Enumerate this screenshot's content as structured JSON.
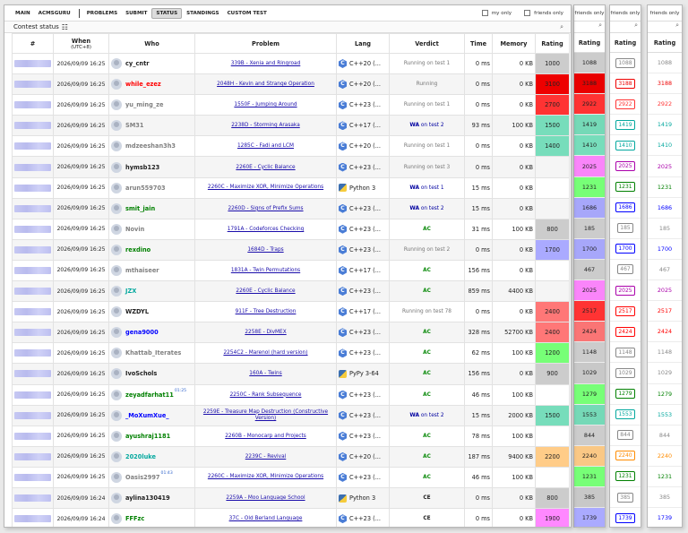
{
  "nav": {
    "items": [
      "MAIN",
      "ACMSGURU",
      "PROBLEMS",
      "SUBMIT",
      "STATUS",
      "STANDINGS",
      "CUSTOM TEST"
    ],
    "active": "STATUS",
    "my_only": "my only",
    "friends_only": "friends only"
  },
  "status": {
    "title": "Contest status"
  },
  "table": {
    "headers": {
      "id": "#",
      "when": "When",
      "when_sub": "(UTC+8)",
      "who": "Who",
      "problem": "Problem",
      "lang": "Lang",
      "verdict": "Verdict",
      "time": "Time",
      "memory": "Memory",
      "rating": "Rating"
    },
    "rows": [
      {
        "when": "2026/09/09 16:25",
        "who": "cy_cntr",
        "who_color": "black",
        "problem": "339B - Xenia and Ringroad",
        "lang": "C++20 (...",
        "lang_icon": "cpp",
        "verdict_type": "running",
        "verdict": "Running on test 1",
        "time": "0 ms",
        "memory": "0 KB",
        "rating": "1000",
        "rating_color": "#cccccc",
        "p1": "1088",
        "p1c": "#cccccc",
        "p2": "1088",
        "p2c": "#888888",
        "p3": "1088",
        "p3c": "#888888"
      },
      {
        "when": "2026/09/09 16:25",
        "who": "while_ezez",
        "who_color": "red",
        "problem": "2048H - Kevin and Strange Operation",
        "lang": "C++20 (...",
        "lang_icon": "cpp",
        "verdict_type": "running",
        "verdict": "Running",
        "time": "0 ms",
        "memory": "0 KB",
        "rating": "3100",
        "rating_color": "#ee0000",
        "p1": "3188",
        "p1c": "#ee0000",
        "p2": "3188",
        "p2c": "#ee0000",
        "p3": "3188",
        "p3c": "#ee0000"
      },
      {
        "when": "2026/09/09 16:25",
        "who": "yu_ming_ze",
        "who_color": "gray",
        "problem": "1550F - Jumping Around",
        "lang": "C++23 (...",
        "lang_icon": "cpp",
        "verdict_type": "running",
        "verdict": "Running on test 1",
        "time": "0 ms",
        "memory": "0 KB",
        "rating": "2700",
        "rating_color": "#ff3333",
        "p1": "2922",
        "p1c": "#ff3333",
        "p2": "2922",
        "p2c": "#ff3333",
        "p3": "2922",
        "p3c": "#ff3333"
      },
      {
        "when": "2026/09/09 16:25",
        "who": "SM31",
        "who_color": "gray",
        "problem": "2238D - Storming Arasaka",
        "lang": "C++17 (...",
        "lang_icon": "cpp",
        "verdict_type": "wa",
        "verdict_prefix": "WA",
        "verdict": "on test 2",
        "time": "93 ms",
        "memory": "100 KB",
        "rating": "1500",
        "rating_color": "#77ddbb",
        "p1": "1419",
        "p1c": "#77ddbb",
        "p2": "1419",
        "p2c": "#03a89e",
        "p3": "1419",
        "p3c": "#03a89e"
      },
      {
        "when": "2026/09/09 16:25",
        "who": "mdzeeshan3h3",
        "who_color": "gray",
        "problem": "1285C - Fadi and LCM",
        "lang": "C++20 (...",
        "lang_icon": "cpp",
        "verdict_type": "running",
        "verdict": "Running on test 1",
        "time": "0 ms",
        "memory": "0 KB",
        "rating": "1400",
        "rating_color": "#77ddbb",
        "p1": "1410",
        "p1c": "#77ddbb",
        "p2": "1410",
        "p2c": "#03a89e",
        "p3": "1410",
        "p3c": "#03a89e"
      },
      {
        "when": "2026/09/09 16:25",
        "who": "hymsb123",
        "who_color": "black",
        "problem": "2260E - Cyclic Balance",
        "lang": "C++23 (...",
        "lang_icon": "cpp",
        "verdict_type": "running",
        "verdict": "Running on test 3",
        "time": "0 ms",
        "memory": "0 KB",
        "rating": "",
        "rating_color": "",
        "p1": "2025",
        "p1c": "#ff88ff",
        "p2": "2025",
        "p2c": "#aa00aa",
        "p3": "2025",
        "p3c": "#aa00aa"
      },
      {
        "when": "2026/09/09 16:25",
        "who": "arun559703",
        "who_color": "gray",
        "problem": "2260C - Maximize XOR, Minimize Operations",
        "lang": "Python 3",
        "lang_icon": "py",
        "verdict_type": "wa",
        "verdict_prefix": "WA",
        "verdict": "on test 1",
        "time": "15 ms",
        "memory": "0 KB",
        "rating": "",
        "rating_color": "",
        "p1": "1231",
        "p1c": "#77ff77",
        "p2": "1231",
        "p2c": "#008000",
        "p3": "1231",
        "p3c": "#008000"
      },
      {
        "when": "2026/09/09 16:25",
        "who": "smit_jain",
        "who_color": "green",
        "problem": "2260D - Signs of Prefix Sums",
        "lang": "C++23 (...",
        "lang_icon": "cpp",
        "verdict_type": "wa",
        "verdict_prefix": "WA",
        "verdict": "on test 2",
        "time": "15 ms",
        "memory": "0 KB",
        "rating": "",
        "rating_color": "",
        "p1": "1686",
        "p1c": "#aaaaff",
        "p2": "1686",
        "p2c": "#0000ff",
        "p3": "1686",
        "p3c": "#0000ff"
      },
      {
        "when": "2026/09/09 16:25",
        "who": "Novin",
        "who_color": "gray",
        "problem": "1791A - Codeforces Checking",
        "lang": "C++23 (...",
        "lang_icon": "cpp",
        "verdict_type": "ac",
        "verdict": "AC",
        "time": "31 ms",
        "memory": "100 KB",
        "rating": "800",
        "rating_color": "#cccccc",
        "p1": "185",
        "p1c": "#cccccc",
        "p2": "185",
        "p2c": "#888888",
        "p3": "185",
        "p3c": "#888888"
      },
      {
        "when": "2026/09/09 16:25",
        "who": "rexdino",
        "who_color": "green",
        "problem": "1684D - Traps",
        "lang": "C++23 (...",
        "lang_icon": "cpp",
        "verdict_type": "running",
        "verdict": "Running on test 2",
        "time": "0 ms",
        "memory": "0 KB",
        "rating": "1700",
        "rating_color": "#aaaaff",
        "p1": "1700",
        "p1c": "#aaaaff",
        "p2": "1700",
        "p2c": "#0000ff",
        "p3": "1700",
        "p3c": "#0000ff"
      },
      {
        "when": "2026/09/09 16:25",
        "who": "mthaiseer",
        "who_color": "gray",
        "problem": "1831A - Twin Permutations",
        "lang": "C++17 (...",
        "lang_icon": "cpp",
        "verdict_type": "ac",
        "verdict": "AC",
        "time": "156 ms",
        "memory": "0 KB",
        "rating": "",
        "rating_color": "",
        "p1": "467",
        "p1c": "#cccccc",
        "p2": "467",
        "p2c": "#888888",
        "p3": "467",
        "p3c": "#888888"
      },
      {
        "when": "2026/09/09 16:25",
        "who": "JZX",
        "who_color": "cyan",
        "problem": "2260E - Cyclic Balance",
        "lang": "C++23 (...",
        "lang_icon": "cpp",
        "verdict_type": "ac",
        "verdict": "AC",
        "time": "859 ms",
        "memory": "4400 KB",
        "rating": "",
        "rating_color": "",
        "p1": "2025",
        "p1c": "#ff88ff",
        "p2": "2025",
        "p2c": "#aa00aa",
        "p3": "2025",
        "p3c": "#aa00aa"
      },
      {
        "when": "2026/09/09 16:25",
        "who": "WZDYL",
        "who_color": "black",
        "problem": "911F - Tree Destruction",
        "lang": "C++17 (...",
        "lang_icon": "cpp",
        "verdict_type": "running",
        "verdict": "Running on test 78",
        "time": "0 ms",
        "memory": "0 KB",
        "rating": "2400",
        "rating_color": "#ff7777",
        "p1": "2517",
        "p1c": "#ff3333",
        "p2": "2517",
        "p2c": "#ff0000",
        "p3": "2517",
        "p3c": "#ff0000"
      },
      {
        "when": "2026/09/09 16:25",
        "who": "gena9000",
        "who_color": "navy",
        "problem": "2258E - DivMEX",
        "lang": "C++23 (...",
        "lang_icon": "cpp",
        "verdict_type": "ac",
        "verdict": "AC",
        "time": "328 ms",
        "memory": "52700 KB",
        "rating": "2400",
        "rating_color": "#ff7777",
        "p1": "2424",
        "p1c": "#ff7777",
        "p2": "2424",
        "p2c": "#ff0000",
        "p3": "2424",
        "p3c": "#ff0000"
      },
      {
        "when": "2026/09/09 16:25",
        "who": "Khattab_Iterates",
        "who_color": "gray",
        "problem": "2254C2 - Marenol (hard version)",
        "lang": "C++23 (...",
        "lang_icon": "cpp",
        "verdict_type": "ac",
        "verdict": "AC",
        "time": "62 ms",
        "memory": "100 KB",
        "rating": "1200",
        "rating_color": "#77ff77",
        "p1": "1148",
        "p1c": "#cccccc",
        "p2": "1148",
        "p2c": "#888888",
        "p3": "1148",
        "p3c": "#888888"
      },
      {
        "when": "2026/09/09 16:25",
        "who": "IvoSchols",
        "who_color": "black",
        "problem": "160A - Twins",
        "lang": "PyPy 3-64",
        "lang_icon": "py",
        "verdict_type": "ac",
        "verdict": "AC",
        "time": "156 ms",
        "memory": "0 KB",
        "rating": "900",
        "rating_color": "#cccccc",
        "p1": "1029",
        "p1c": "#cccccc",
        "p2": "1029",
        "p2c": "#888888",
        "p3": "1029",
        "p3c": "#888888"
      },
      {
        "when": "2026/09/09 16:25",
        "who": "zeyadfarhat11",
        "who_color": "green",
        "who_sup": "01:25",
        "problem": "2250C - Rank Subsequence",
        "lang": "C++23 (...",
        "lang_icon": "cpp",
        "verdict_type": "ac",
        "verdict": "AC",
        "time": "46 ms",
        "memory": "100 KB",
        "rating": "",
        "rating_color": "",
        "p1": "1279",
        "p1c": "#77ff77",
        "p2": "1279",
        "p2c": "#008000",
        "p3": "1279",
        "p3c": "#008000"
      },
      {
        "when": "2026/09/09 16:25",
        "who": "_MoXumXue_",
        "who_color": "navy",
        "problem": "2259E - Treasure Map Destruction (Constructive Version)",
        "lang": "C++23 (...",
        "lang_icon": "cpp",
        "verdict_type": "wa",
        "verdict_prefix": "WA",
        "verdict": "on test 2",
        "time": "15 ms",
        "memory": "2000 KB",
        "rating": "1500",
        "rating_color": "#77ddbb",
        "p1": "1553",
        "p1c": "#77ddbb",
        "p2": "1553",
        "p2c": "#03a89e",
        "p3": "1553",
        "p3c": "#03a89e"
      },
      {
        "when": "2026/09/09 16:25",
        "who": "ayushraj1181",
        "who_color": "green",
        "problem": "2260B - Monocarp and Projects",
        "lang": "C++23 (...",
        "lang_icon": "cpp",
        "verdict_type": "ac",
        "verdict": "AC",
        "time": "78 ms",
        "memory": "100 KB",
        "rating": "",
        "rating_color": "",
        "p1": "844",
        "p1c": "#cccccc",
        "p2": "844",
        "p2c": "#888888",
        "p3": "844",
        "p3c": "#888888"
      },
      {
        "when": "2026/09/09 16:25",
        "who": "2020luke",
        "who_color": "cyan",
        "problem": "2239C - Revival",
        "lang": "C++20 (...",
        "lang_icon": "cpp",
        "verdict_type": "ac",
        "verdict": "AC",
        "time": "187 ms",
        "memory": "9400 KB",
        "rating": "2200",
        "rating_color": "#ffcc88",
        "p1": "2240",
        "p1c": "#ffcc88",
        "p2": "2240",
        "p2c": "#ff8c00",
        "p3": "2240",
        "p3c": "#ff8c00"
      },
      {
        "when": "2026/09/09 16:25",
        "who": "Oasis2997",
        "who_color": "gray",
        "who_sup": "01:43",
        "problem": "2260C - Maximize XOR, Minimize Operations",
        "lang": "C++23 (...",
        "lang_icon": "cpp",
        "verdict_type": "ac",
        "verdict": "AC",
        "time": "46 ms",
        "memory": "100 KB",
        "rating": "",
        "rating_color": "",
        "p1": "1231",
        "p1c": "#77ff77",
        "p2": "1231",
        "p2c": "#008000",
        "p3": "1231",
        "p3c": "#008000"
      },
      {
        "when": "2026/09/09 16:24",
        "who": "aylina130419",
        "who_color": "black",
        "problem": "2259A - Moo Language School",
        "lang": "Python 3",
        "lang_icon": "py",
        "verdict_type": "ce",
        "verdict": "CE",
        "time": "0 ms",
        "memory": "0 KB",
        "rating": "800",
        "rating_color": "#cccccc",
        "p1": "385",
        "p1c": "#cccccc",
        "p2": "385",
        "p2c": "#888888",
        "p3": "385",
        "p3c": "#888888"
      },
      {
        "when": "2026/09/09 16:24",
        "who": "FFFzc",
        "who_color": "green",
        "problem": "37C - Old Berland Language",
        "lang": "C++23 (...",
        "lang_icon": "cpp",
        "verdict_type": "ce",
        "verdict": "CE",
        "time": "0 ms",
        "memory": "0 KB",
        "rating": "1900",
        "rating_color": "#ff88ff",
        "p1": "1739",
        "p1c": "#aaaaff",
        "p2": "1739",
        "p2c": "#0000ff",
        "p3": "1739",
        "p3c": "#0000ff"
      }
    ]
  },
  "panels": {
    "friends_label": "friends only",
    "rating_label": "Rating"
  }
}
